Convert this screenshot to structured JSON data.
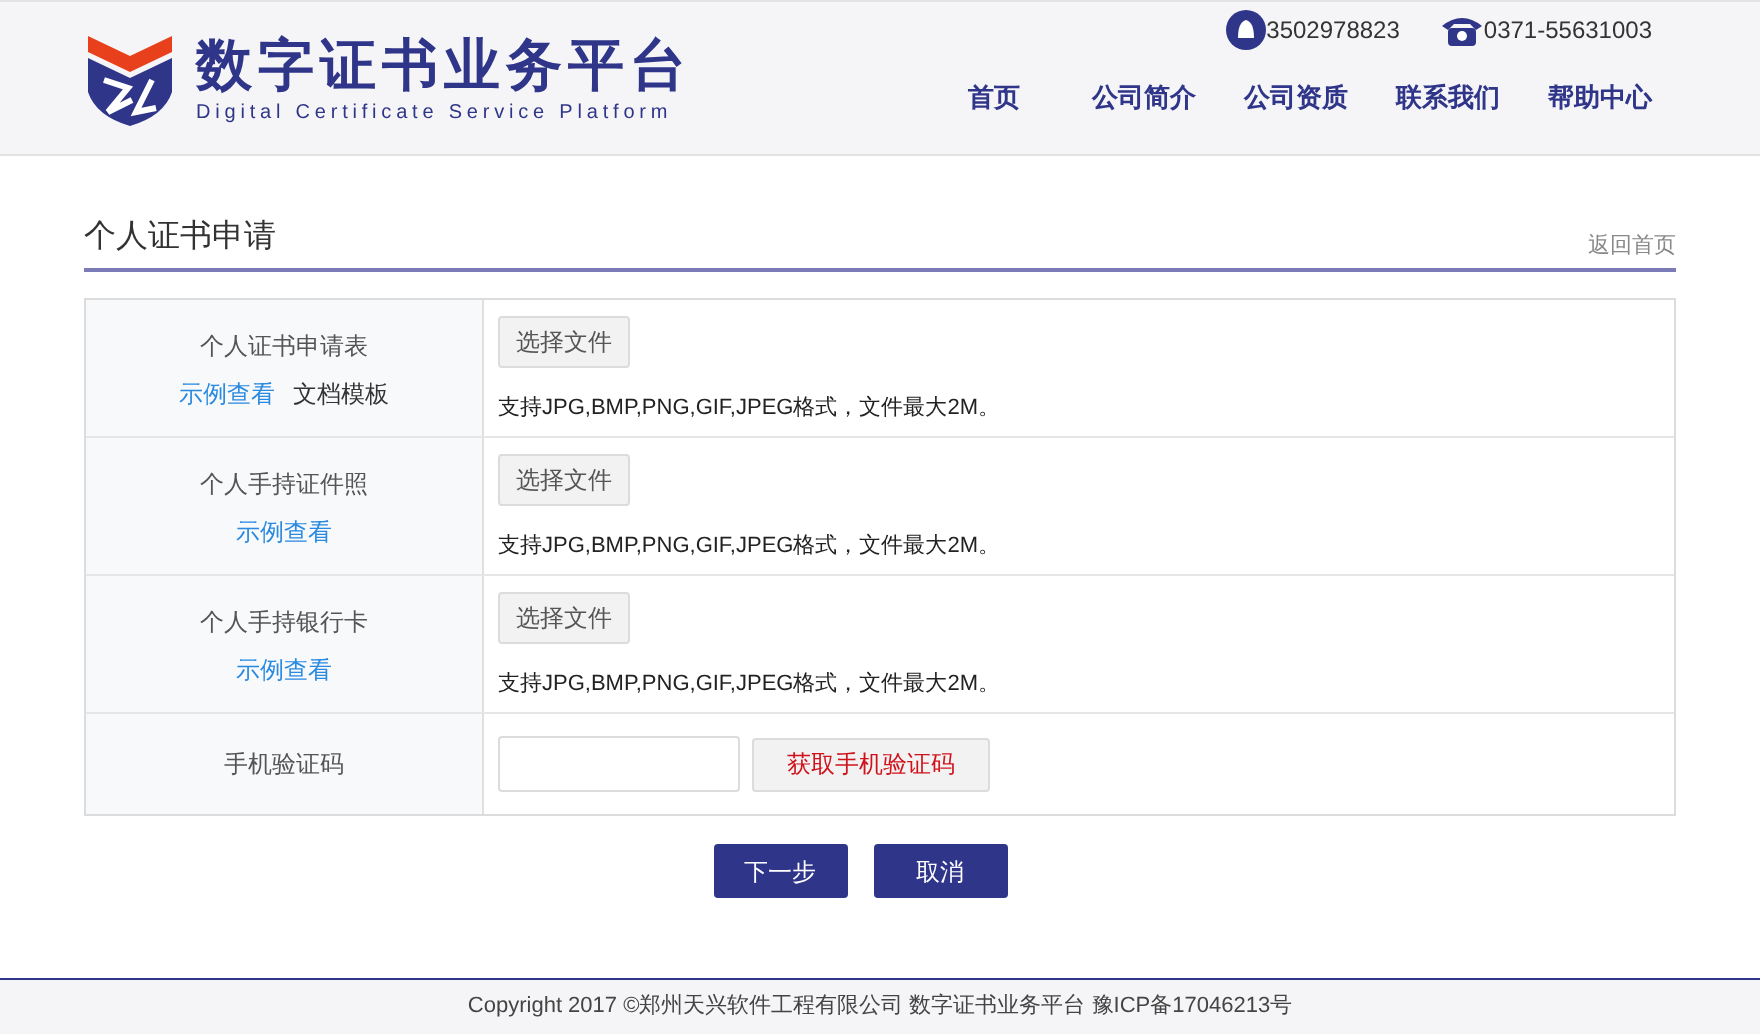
{
  "header": {
    "title": "数字证书业务平台",
    "subtitle": "Digital Certificate Service Platform",
    "qq": "3502978823",
    "phone": "0371-55631003",
    "nav": [
      "首页",
      "公司简介",
      "公司资质",
      "联系我们",
      "帮助中心"
    ]
  },
  "section": {
    "title": "个人证书申请",
    "back_link": "返回首页"
  },
  "rows": [
    {
      "kind": "file",
      "label": "个人证书申请表",
      "links": [
        {
          "text": "示例查看",
          "kind": "link"
        },
        {
          "text": "文档模板",
          "kind": "plain"
        }
      ],
      "button": "选择文件",
      "hint": "支持JPG,BMP,PNG,GIF,JPEG格式，文件最大2M。"
    },
    {
      "kind": "file",
      "label": "个人手持证件照",
      "links": [
        {
          "text": "示例查看",
          "kind": "link"
        }
      ],
      "button": "选择文件",
      "hint": "支持JPG,BMP,PNG,GIF,JPEG格式，文件最大2M。"
    },
    {
      "kind": "file",
      "label": "个人手持银行卡",
      "links": [
        {
          "text": "示例查看",
          "kind": "link"
        }
      ],
      "button": "选择文件",
      "hint": "支持JPG,BMP,PNG,GIF,JPEG格式，文件最大2M。"
    },
    {
      "kind": "sms",
      "label": "手机验证码",
      "button": "获取手机验证码"
    }
  ],
  "actions": [
    "下一步",
    "取消"
  ],
  "footer": "Copyright 2017 ©郑州天兴软件工程有限公司 数字证书业务平台 豫ICP备17046213号"
}
